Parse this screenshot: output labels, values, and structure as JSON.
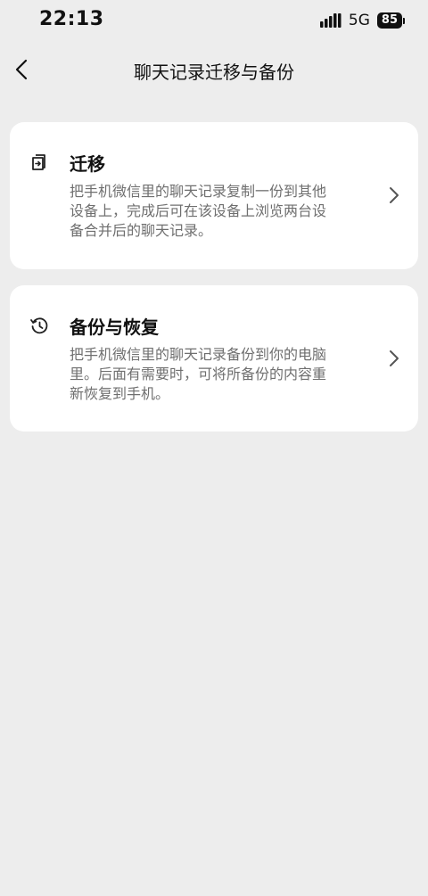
{
  "status_bar": {
    "time": "22:13",
    "network": "5G",
    "battery": "85",
    "icons": [
      "signal-icon",
      "battery-icon"
    ]
  },
  "nav": {
    "title": "聊天记录迁移与备份",
    "back_icon": "chevron-left-icon"
  },
  "cards": [
    {
      "title": "迁移",
      "description": "把手机微信里的聊天记录复制一份到其他设备上，完成后可在该设备上浏览两台设备合并后的聊天记录。",
      "icon": "migrate-icon"
    },
    {
      "title": "备份与恢复",
      "description": "把手机微信里的聊天记录备份到你的电脑里。后面有需要时，可将所备份的内容重新恢复到手机。",
      "icon": "history-icon"
    }
  ]
}
